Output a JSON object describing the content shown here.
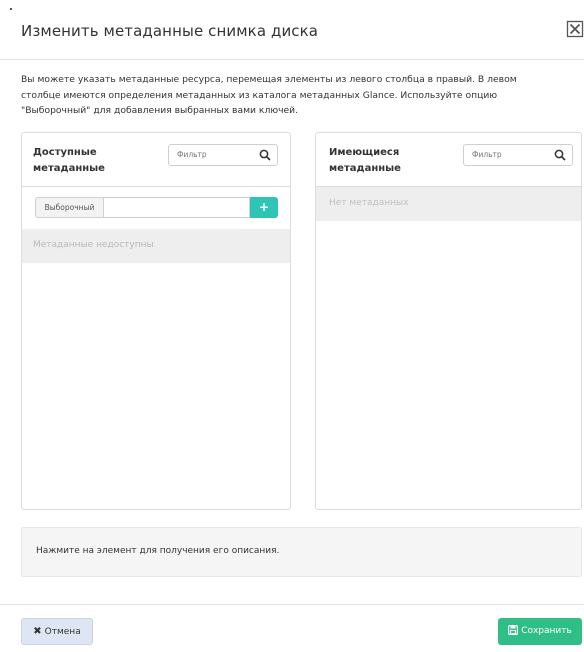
{
  "modal": {
    "title": "Изменить метаданные снимка диска",
    "help_line1": "Вы можете указать метаданные ресурса, перемещая элементы из левого столбца в правый. В левом",
    "help_line2": "столбце имеются определения метаданных из каталога метаданных Glance. Используйте опцию",
    "help_line3": "\"Выборочный\" для добавления выбранных вами ключей."
  },
  "available": {
    "title_line1": "Доступные",
    "title_line2": "метаданные",
    "filter_placeholder": "Фильтр",
    "custom_label": "Выборочный",
    "add_icon": "plus-icon",
    "empty_text": "Метаданные недоступны"
  },
  "existing": {
    "title_line1": "Имеющиеся",
    "title_line2": "метаданные",
    "filter_placeholder": "Фильтр",
    "empty_text": "Нет метаданных"
  },
  "description": {
    "text": "Нажмите на элемент для получения его описания."
  },
  "footer": {
    "cancel_label": "Отмена",
    "save_label": "Сохранить"
  },
  "colors": {
    "primary_green": "#2fbe86",
    "add_button_teal": "#2ec4b6",
    "cancel_bg": "#dde6f2"
  }
}
